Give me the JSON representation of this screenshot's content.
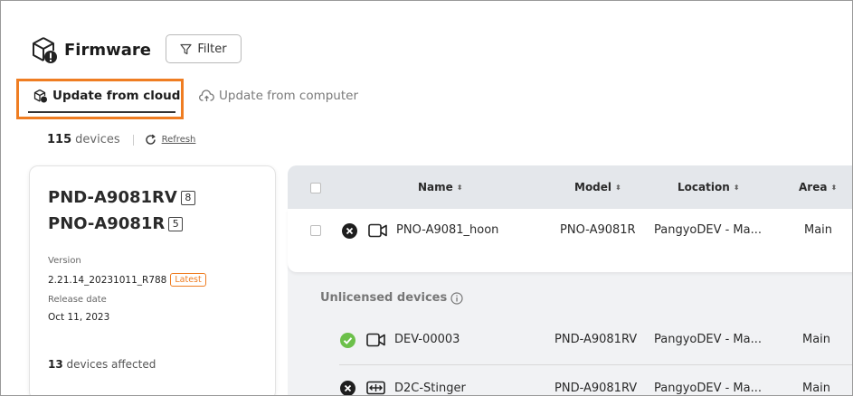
{
  "header": {
    "title": "Firmware",
    "filter_label": "Filter"
  },
  "tabs": [
    {
      "label": "Update from cloud",
      "active": true
    },
    {
      "label": "Update from computer",
      "active": false
    }
  ],
  "summary": {
    "count": "115",
    "unit": "devices",
    "refresh_label": "Refresh"
  },
  "firmware_card": {
    "models": [
      {
        "name": "PND-A9081RV",
        "count": "8"
      },
      {
        "name": "PNO-A9081R",
        "count": "5"
      }
    ],
    "version_label": "Version",
    "version_value": "2.21.14_20231011_R788",
    "latest_badge": "Latest",
    "release_label": "Release date",
    "release_value": "Oct 11, 2023",
    "affected_count": "13",
    "affected_text": "devices affected"
  },
  "table": {
    "columns": [
      "Name",
      "Model",
      "Location",
      "Area"
    ],
    "sort_glyph": "⬍",
    "licensed_rows": [
      {
        "status": "error",
        "device_icon": "camera-icon",
        "name": "PNO-A9081_hoon",
        "model": "PNO-A9081R",
        "location": "PangyoDEV - Ma...",
        "area": "Main"
      }
    ],
    "unlicensed_title": "Unlicensed devices",
    "unlicensed_rows": [
      {
        "status": "ok",
        "device_icon": "camera-icon",
        "name": "DEV-00003",
        "model": "PND-A9081RV",
        "location": "PangyoDEV - Ma...",
        "area": "Main"
      },
      {
        "status": "error",
        "device_icon": "stretch-icon",
        "name": "D2C-Stinger",
        "model": "PND-A9081RV",
        "location": "PangyoDEV - Ma...",
        "area": "Main"
      }
    ]
  },
  "colors": {
    "accent": "#ef7d22",
    "ok": "#6cc04a",
    "error": "#1e1e1e",
    "header_bg": "#e4e7eb"
  }
}
